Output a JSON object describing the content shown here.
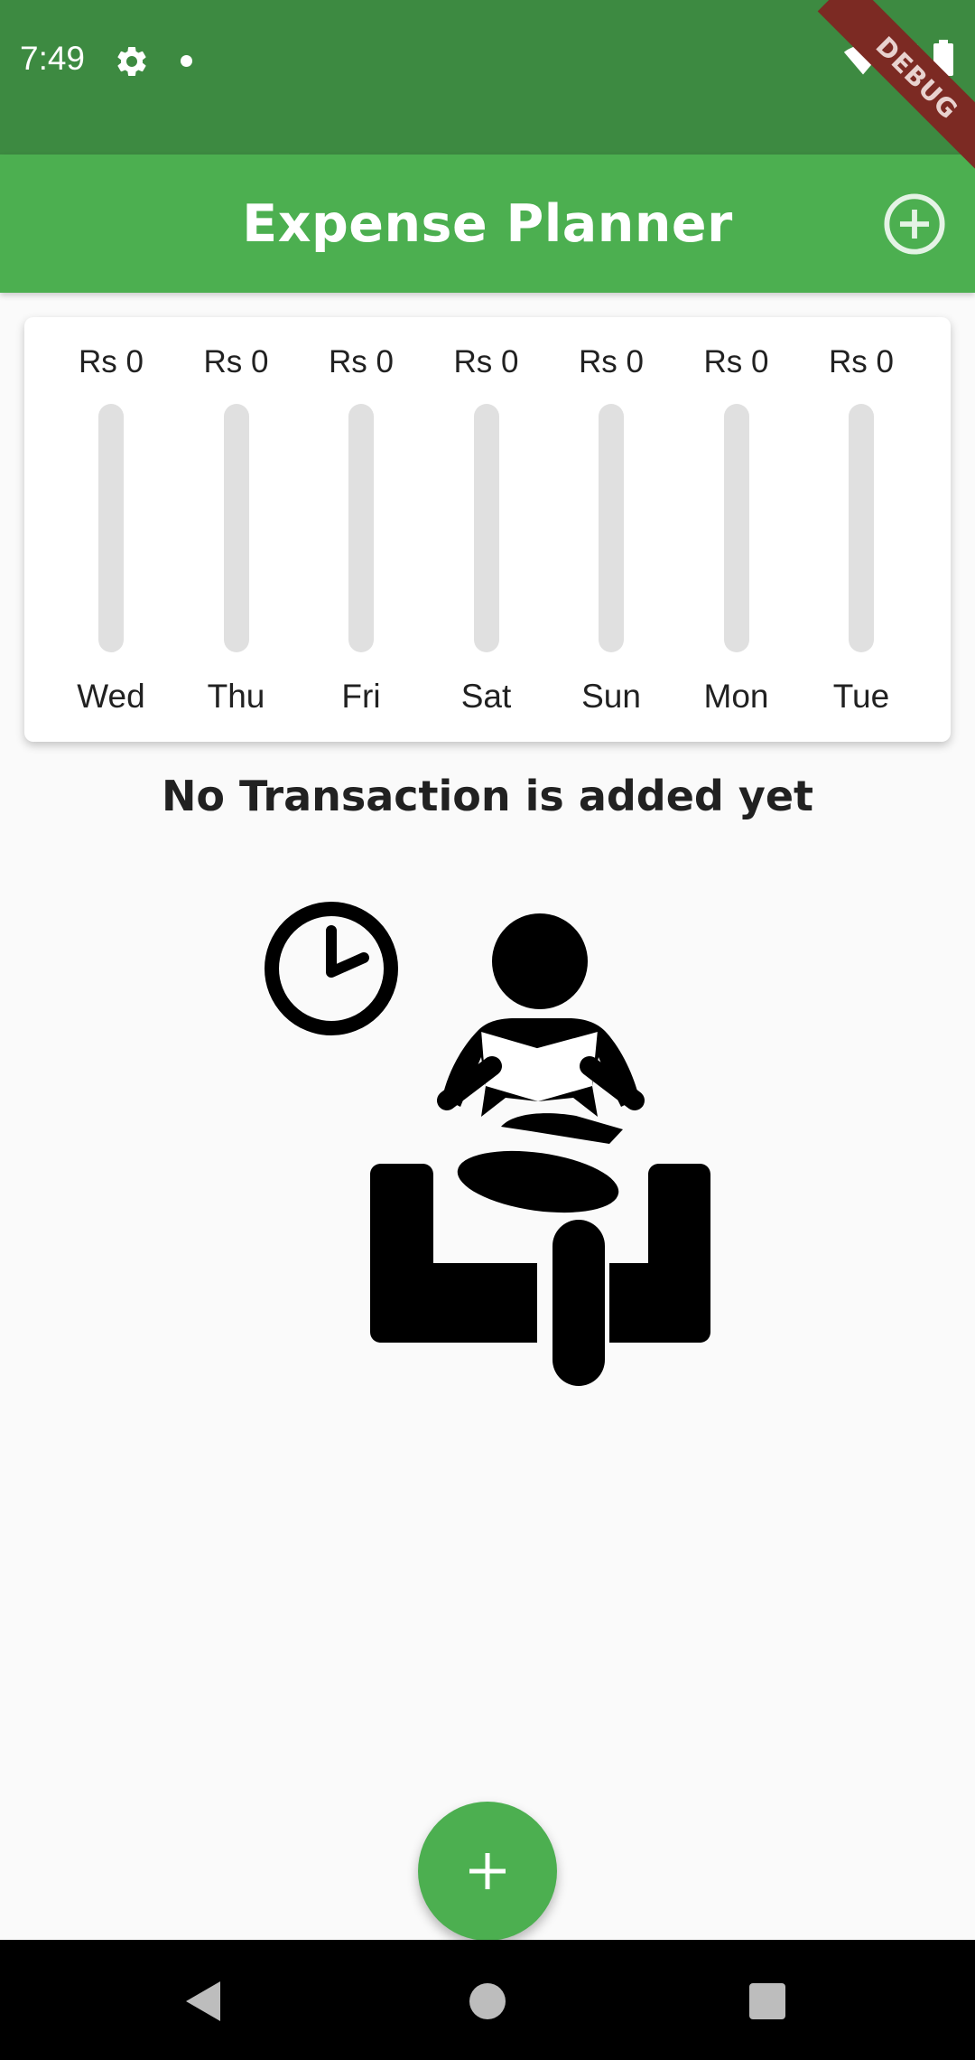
{
  "status_bar": {
    "time": "7:49",
    "icons": [
      "gear-icon",
      "notification-dot-icon",
      "wifi-icon",
      "signal-icon",
      "battery-icon"
    ]
  },
  "debug_banner": {
    "label": "DEBUG"
  },
  "app_bar": {
    "title": "Expense Planner",
    "action_icon": "add-circle-icon"
  },
  "chart_data": {
    "type": "bar",
    "categories": [
      "Wed",
      "Thu",
      "Fri",
      "Sat",
      "Sun",
      "Mon",
      "Tue"
    ],
    "values": [
      0,
      0,
      0,
      0,
      0,
      0,
      0
    ],
    "value_labels": [
      "Rs 0",
      "Rs 0",
      "Rs 0",
      "Rs 0",
      "Rs 0",
      "Rs 0",
      "Rs 0"
    ],
    "fill_fraction": [
      0,
      0,
      0,
      0,
      0,
      0,
      0
    ],
    "title": "",
    "xlabel": "",
    "ylabel": ""
  },
  "empty_state": {
    "message": "No Transaction is added yet",
    "illustration_icon": "waiting-person-icon"
  },
  "fab": {
    "icon": "plus-icon"
  },
  "nav_bar": {
    "icons": [
      "back-icon",
      "home-icon",
      "recents-icon"
    ]
  },
  "colors": {
    "status_bar": "#3d8a41",
    "app_bar": "#4caf50",
    "accent": "#4caf50",
    "bar_track": "#e0e0e0",
    "background": "#fafafa",
    "debug_banner": "#7c2a23"
  }
}
